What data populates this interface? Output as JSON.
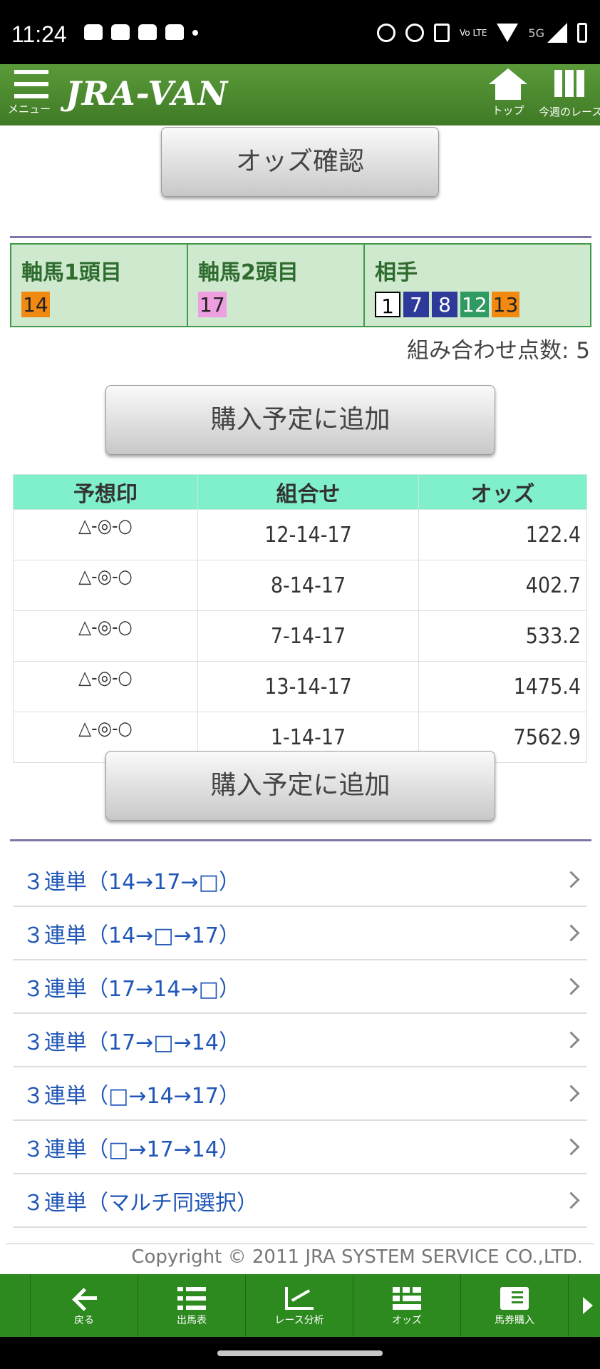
{
  "statusbar": {
    "time": "11:24",
    "net": "5G",
    "volte": "Vo LTE"
  },
  "header": {
    "menu_label": "メニュー",
    "logo": "JRA-VAN",
    "top_label": "トップ",
    "week_label": "今週のレース"
  },
  "odds_confirm_button": "オッズ確認",
  "selection": {
    "axis1": {
      "label": "軸馬1頭目",
      "numbers": [
        {
          "n": "14",
          "bg": "#f28a12",
          "fg": "#222"
        }
      ]
    },
    "axis2": {
      "label": "軸馬2頭目",
      "numbers": [
        {
          "n": "17",
          "bg": "#ee9fe0",
          "fg": "#222"
        }
      ]
    },
    "partner": {
      "label": "相手",
      "numbers": [
        {
          "n": "1",
          "bg": "#ffffff",
          "fg": "#000"
        },
        {
          "n": "7",
          "bg": "#2d3a9a",
          "fg": "#fff"
        },
        {
          "n": "8",
          "bg": "#2d3a9a",
          "fg": "#fff"
        },
        {
          "n": "12",
          "bg": "#2f9a62",
          "fg": "#fff"
        },
        {
          "n": "13",
          "bg": "#f28a12",
          "fg": "#222"
        }
      ]
    }
  },
  "combination_count": "組み合わせ点数: 5",
  "add_button_label": "購入予定に追加",
  "odds_table": {
    "headers": [
      "予想印",
      "組合せ",
      "オッズ"
    ],
    "rows": [
      {
        "mark": "△-◎-○",
        "combo": "12-14-17",
        "odds": "122.4"
      },
      {
        "mark": "△-◎-○",
        "combo": "8-14-17",
        "odds": "402.7"
      },
      {
        "mark": "△-◎-○",
        "combo": "7-14-17",
        "odds": "533.2"
      },
      {
        "mark": "△-◎-○",
        "combo": "13-14-17",
        "odds": "1475.4"
      },
      {
        "mark": "△-◎-○",
        "combo": "1-14-17",
        "odds": "7562.9"
      }
    ]
  },
  "links": [
    "３連単（14→17→□）",
    "３連単（14→□→17）",
    "３連単（17→14→□）",
    "３連単（17→□→14）",
    "３連単（□→14→17）",
    "３連単（□→17→14）",
    "３連単（マルチ同選択）"
  ],
  "copyright": "Copyright © 2011 JRA SYSTEM SERVICE CO.,LTD.",
  "bottom_nav": [
    "戻る",
    "出馬表",
    "レース分析",
    "オッズ",
    "馬券購入"
  ]
}
